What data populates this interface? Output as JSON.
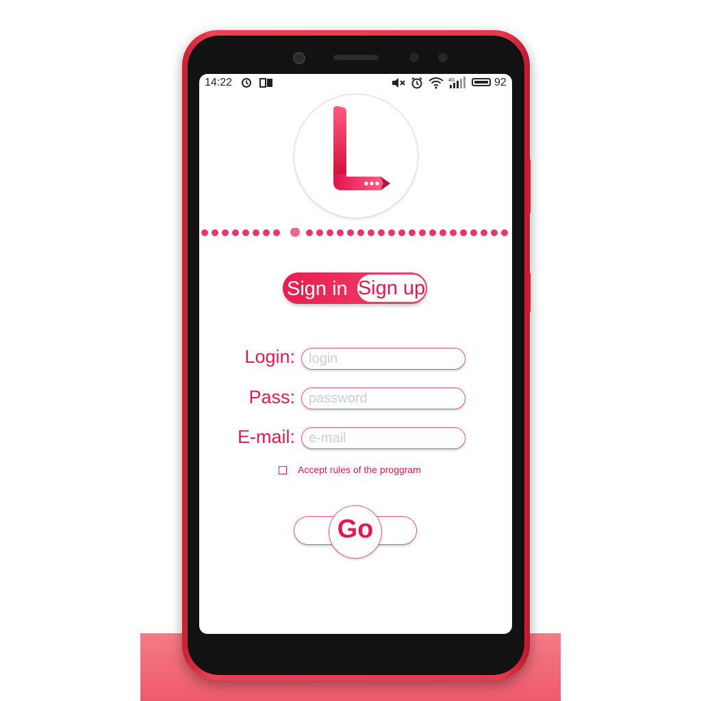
{
  "status_bar": {
    "time": "14:22",
    "battery": "92"
  },
  "auth_toggle": {
    "sign_in_label": "Sign in",
    "sign_up_label": "Sign up",
    "selected": "Sign up"
  },
  "form": {
    "login_label": "Login:",
    "login_placeholder": "login",
    "pass_label": "Pass:",
    "pass_placeholder": "password",
    "email_label": "E-mail:",
    "email_placeholder": "e-mail",
    "accept_label": "Accept  rules of the proggram",
    "accept_checked": false,
    "go_label": "Go"
  },
  "colors": {
    "accent": "#e2184e",
    "phone_body": "#e8384c",
    "floor": "#f06474"
  },
  "icons": [
    "alarm-clock-icon",
    "sim-card-icon",
    "mute-icon",
    "alarm-icon",
    "wifi-icon",
    "signal-icon",
    "battery-icon",
    "logo-l-arrow-icon",
    "dotted-divider"
  ]
}
